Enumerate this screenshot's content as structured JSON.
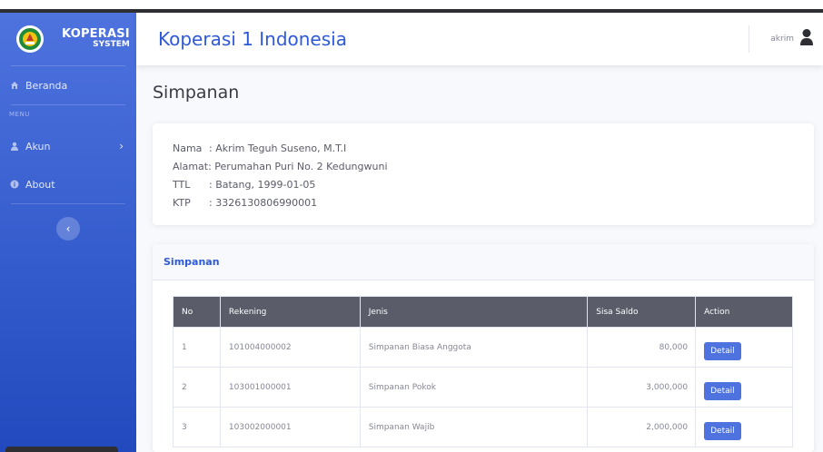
{
  "sidebar": {
    "brand": {
      "line1": "KOPERASI",
      "line2": "SYSTEM"
    },
    "items": [
      {
        "label": "Beranda",
        "icon": "home-icon"
      },
      {
        "label": "Akun",
        "icon": "user-icon"
      },
      {
        "label": "About",
        "icon": "info-icon"
      }
    ],
    "menu_heading": "MENU",
    "toggle_icon": "chevron-left-icon"
  },
  "topbar": {
    "title": "Koperasi 1 Indonesia",
    "user_name": "akrim"
  },
  "page": {
    "heading": "Simpanan"
  },
  "profile": {
    "nama_label": "Nama",
    "nama_value": ": Akrim Teguh Suseno, M.T.I",
    "alamat_label": "Alamat:",
    "alamat_value": " Perumahan Puri No. 2 Kedungwuni",
    "ttl_label": "TTL",
    "ttl_value": ": Batang, 1999-01-05",
    "ktp_label": "KTP",
    "ktp_value": ": 3326130806990001"
  },
  "table_card": {
    "title": "Simpanan",
    "columns": [
      "No",
      "Rekening",
      "Jenis",
      "Sisa Saldo",
      "Action"
    ],
    "rows": [
      {
        "no": "1",
        "rekening": "101004000002",
        "jenis": "Simpanan Biasa Anggota",
        "saldo": "80,000",
        "action": "Detail"
      },
      {
        "no": "2",
        "rekening": "103001000001",
        "jenis": "Simpanan Pokok",
        "saldo": "3,000,000",
        "action": "Detail"
      },
      {
        "no": "3",
        "rekening": "103002000001",
        "jenis": "Simpanan Wajib",
        "saldo": "2,000,000",
        "action": "Detail"
      }
    ]
  },
  "colors": {
    "primary": "#4e73df",
    "sidebar_dark": "#224abe",
    "table_header": "#5a5c69"
  }
}
